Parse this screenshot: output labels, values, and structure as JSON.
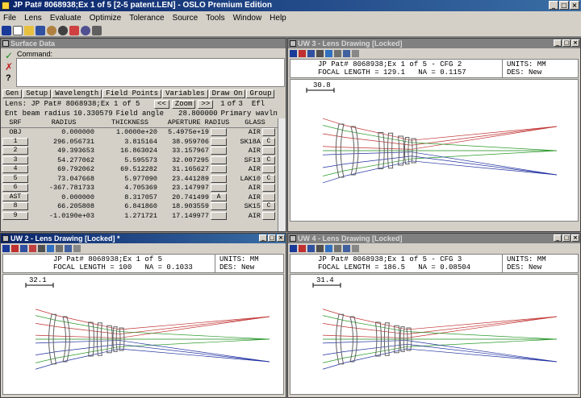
{
  "app": {
    "title": "JP Pat# 8068938;Ex 1 of 5 [2-5 patent.LEN] - OSLO Premium Edition",
    "menu": [
      "File",
      "Lens",
      "Evaluate",
      "Optimize",
      "Tolerance",
      "Source",
      "Tools",
      "Window",
      "Help"
    ]
  },
  "surface_data": {
    "title": "Surface Data",
    "command_label": "Command:",
    "buttons": [
      "Gen",
      "Setup",
      "Wavelength",
      "Field Points",
      "Variables",
      "Draw On",
      "Group"
    ],
    "lens_label": "Lens: JP Pat# 8068938;Ex 1 of 5",
    "zoom_prev": "<<",
    "zoom_label": "Zoom",
    "zoom_next": ">>",
    "config_current": "1",
    "config_of": "of",
    "config_total": "3",
    "efl_label": "Efl",
    "ebr_label": "Ent beam radius",
    "ebr_value": "10.330579",
    "field_angle_label": "Field angle",
    "field_angle_value": "28.800000",
    "primary_label": "Primary wavln",
    "columns": [
      "SRF",
      "RADIUS",
      "THICKNESS",
      "APERTURE RADIUS",
      "GLASS"
    ],
    "rows": [
      {
        "srf": "OBJ",
        "radius": "0.000000",
        "thickness": "1.0000e+20",
        "aperture": "5.4975e+19",
        "ap_btn": "",
        "glass": "AIR",
        "glass_btn": ""
      },
      {
        "srf": "1",
        "radius": "296.056731",
        "thickness": "3.815164",
        "aperture": "38.959706",
        "ap_btn": "",
        "glass": "SK18A",
        "glass_btn": "C"
      },
      {
        "srf": "2",
        "radius": "49.393653",
        "thickness": "16.863024",
        "aperture": "33.157967",
        "ap_btn": "",
        "glass": "AIR",
        "glass_btn": ""
      },
      {
        "srf": "3",
        "radius": "54.277062",
        "thickness": "5.595573",
        "aperture": "32.007295",
        "ap_btn": "",
        "glass": "SF13",
        "glass_btn": "C"
      },
      {
        "srf": "4",
        "radius": "69.792062",
        "thickness": "69.512282",
        "aperture": "31.165627",
        "ap_btn": "",
        "glass": "AIR",
        "glass_btn": ""
      },
      {
        "srf": "5",
        "radius": "73.047668",
        "thickness": "5.977090",
        "aperture": "23.441289",
        "ap_btn": "",
        "glass": "LAK10",
        "glass_btn": "C"
      },
      {
        "srf": "6",
        "radius": "-367.781733",
        "thickness": "4.705369",
        "aperture": "23.147997",
        "ap_btn": "",
        "glass": "AIR",
        "glass_btn": ""
      },
      {
        "srf": "AST",
        "radius": "0.000000",
        "thickness": "8.317057",
        "aperture": "20.741499",
        "ap_btn": "A",
        "glass": "AIR",
        "glass_btn": ""
      },
      {
        "srf": "8",
        "radius": "66.205808",
        "thickness": "6.841860",
        "aperture": "18.903559",
        "ap_btn": "",
        "glass": "SK15",
        "glass_btn": "C"
      },
      {
        "srf": "9",
        "radius": "-1.0190e+03",
        "thickness": "1.271721",
        "aperture": "17.149977",
        "ap_btn": "",
        "glass": "AIR",
        "glass_btn": ""
      }
    ]
  },
  "uw3": {
    "title": "UW 3 - Lens Drawing [Locked]",
    "line1": "JP Pat# 8068938;Ex 1 of 5 - CFG 2",
    "line2": "FOCAL LENGTH = 129.1   NA = 0.1157",
    "units": "UNITS: MM",
    "des": "DES: New",
    "scale": "30.8"
  },
  "uw2": {
    "title": "UW 2 - Lens Drawing [Locked] *",
    "line1": "JP Pat# 8068938;Ex 1 of 5",
    "line2": "FOCAL LENGTH = 100   NA = 0.1033",
    "units": "UNITS: MM",
    "des": "DES: New",
    "scale": "32.1"
  },
  "uw4": {
    "title": "UW 4 - Lens Drawing [Locked]",
    "line1": "JP Pat# 8068938;Ex 1 of 5 - CFG 3",
    "line2": "FOCAL LENGTH = 186.5   NA = 0.08504",
    "units": "UNITS: MM",
    "des": "DES: New",
    "scale": "31.4"
  },
  "colors": {
    "titlebar": "#0a246a",
    "ray_red": "#c03030",
    "ray_green": "#2a9a2a",
    "ray_blue": "#2030a0",
    "lens": "#606060"
  }
}
